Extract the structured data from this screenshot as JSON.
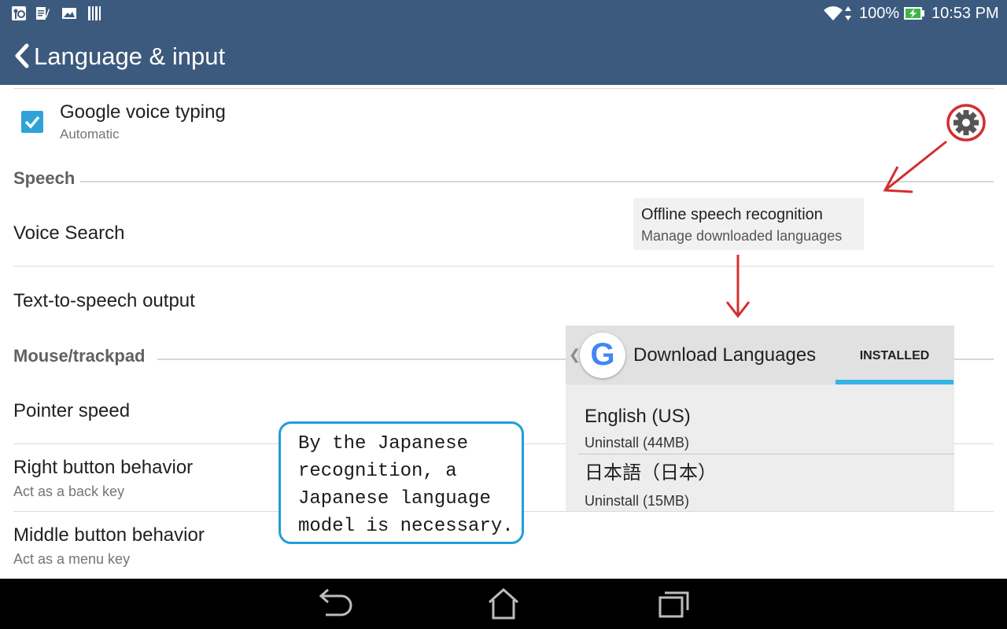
{
  "status_bar": {
    "battery": "100%",
    "time": "10:53 PM",
    "icons": [
      "notification-app-icon",
      "notification-doc-icon",
      "notification-image-icon",
      "notification-barcode-icon",
      "wifi-icon",
      "data-arrows-icon",
      "battery-charging-icon"
    ]
  },
  "action_bar": {
    "title": "Language & input",
    "back_icon": "chevron-left-icon"
  },
  "settings": {
    "voice_typing": {
      "title": "Google voice typing",
      "summary": "Automatic",
      "checked": true,
      "settings_icon": "gear-icon"
    },
    "speech_category": "Speech",
    "voice_search": "Voice Search",
    "tts_output": "Text-to-speech output",
    "mouse_category": "Mouse/trackpad",
    "pointer_speed": "Pointer speed",
    "right_button": {
      "title": "Right button behavior",
      "summary": "Act as a back key"
    },
    "middle_button": {
      "title": "Middle button behavior",
      "summary": "Act as a menu key"
    }
  },
  "offline_box": {
    "title": "Offline speech recognition",
    "summary": "Manage downloaded languages"
  },
  "download_panel": {
    "back_glyph": "❮",
    "logo_letter": "G",
    "title": "Download Languages",
    "tab": "INSTALLED",
    "languages": [
      {
        "name": "English (US)",
        "action": "Uninstall (44MB)"
      },
      {
        "name": "日本語（日本）",
        "action": "Uninstall (15MB)"
      }
    ]
  },
  "callout": {
    "text": "By the Japanese recognition, a Japanese language model is necessary."
  },
  "nav_bar": {
    "icons": [
      "back-icon",
      "home-icon",
      "recent-apps-icon"
    ]
  },
  "colors": {
    "app_bar": "#3c5a7e",
    "accent": "#2fa3d8",
    "annotation_red": "#d32f2f",
    "callout_border": "#1e9fd8",
    "tab_indicator": "#33b5e5"
  }
}
